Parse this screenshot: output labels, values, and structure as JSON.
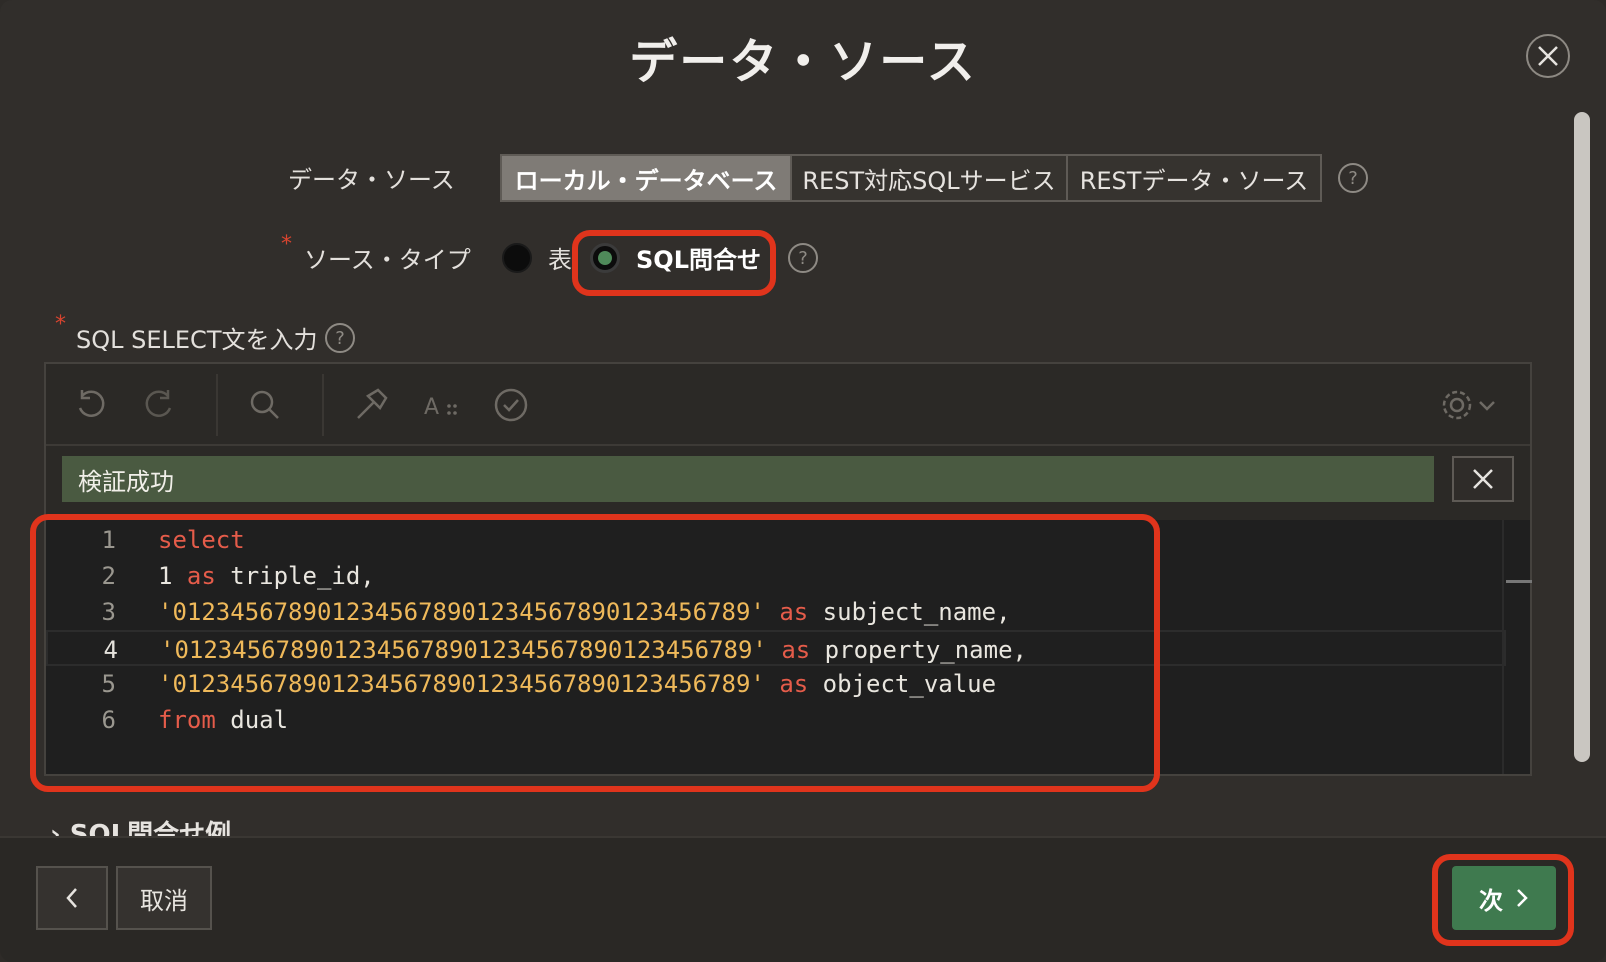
{
  "dialog": {
    "title": "データ・ソース",
    "close_icon": "close-icon"
  },
  "data_source": {
    "label": "データ・ソース",
    "options": [
      "ローカル・データベース",
      "REST対応SQLサービス",
      "RESTデータ・ソース"
    ],
    "selected": "ローカル・データベース",
    "help": "?"
  },
  "source_type": {
    "required_mark": "*",
    "label": "ソース・タイプ",
    "options": [
      "表",
      "SQL問合せ"
    ],
    "selected": "SQL問合せ",
    "help": "?"
  },
  "sql_input": {
    "required_mark": "*",
    "label": "SQL SELECT文を入力",
    "help": "?",
    "toolbar_icons": [
      "undo-icon",
      "redo-icon",
      "search-icon",
      "hammer-icon",
      "text-format-icon",
      "validate-icon",
      "gear-icon",
      "chevron-down-icon"
    ],
    "validation_message": "検証成功",
    "line_numbers": [
      "1",
      "2",
      "3",
      "4",
      "5",
      "6"
    ],
    "current_line": 4,
    "code_lines": [
      "select",
      "1 as triple_id,",
      "'0123456789012345678901234567890123456789' as subject_name,",
      "'0123456789012345678901234567890123456789' as property_name,",
      "'0123456789012345678901234567890123456789' as object_value",
      "from dual"
    ]
  },
  "sql_examples": {
    "label": "SQL問合せ例"
  },
  "footer": {
    "back_icon": "chevron-left-icon",
    "cancel_label": "取消",
    "next_label": "次",
    "next_icon": "chevron-right-icon"
  },
  "colors": {
    "background": "#312e2b",
    "accent_green": "#3f7a4f",
    "success_bar": "#4a5a41",
    "highlight_red": "#e0341c",
    "keyword": "#e55c4a",
    "string": "#efb95a"
  }
}
